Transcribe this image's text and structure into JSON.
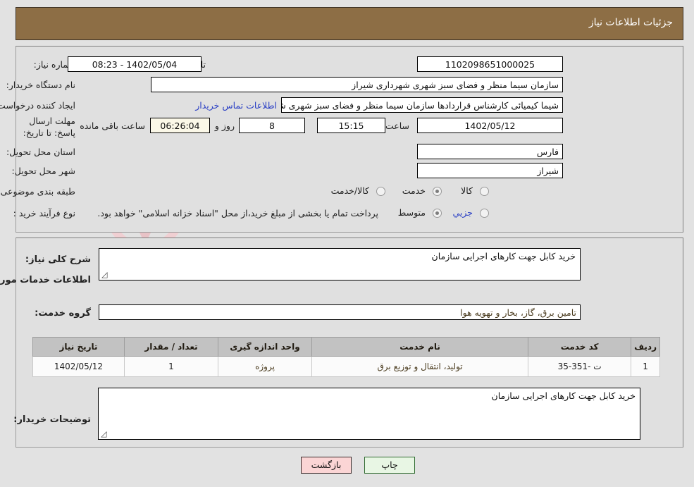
{
  "header": {
    "title": "جزئیات اطلاعات نیاز"
  },
  "form": {
    "need_number_label": "شماره نیاز:",
    "need_number_value": "1102098651000025",
    "announce_label": "تاریخ و ساعت اعلان عمومی:",
    "announce_value": "1402/05/04 - 08:23",
    "buyer_org_label": "نام دستگاه خریدار:",
    "buyer_org_value": "سازمان سیما منظر و فضای سبز شهری شهرداری شیراز",
    "creator_label": "ایجاد کننده درخواست:",
    "creator_value": "شیما کیمیائی کارشناس قراردادها سازمان سیما منظر و فضای سبز شهری شهـ",
    "contact_link": "اطلاعات تماس خریدار",
    "deadline_label": "مهلت ارسال پاسخ: تا تاریخ:",
    "deadline_date": "1402/05/12",
    "time_label": "ساعت",
    "deadline_time": "15:15",
    "days_value": "8",
    "days_label": "روز و",
    "countdown_value": "06:26:04",
    "remaining_label": "ساعت باقی مانده",
    "province_label": "استان محل تحویل:",
    "province_value": "فارس",
    "city_label": "شهر محل تحویل:",
    "city_value": "شیراز",
    "category_label": "طبقه بندی موضوعی:",
    "category_options": [
      {
        "label": "کالا",
        "selected": false
      },
      {
        "label": "خدمت",
        "selected": true
      },
      {
        "label": "کالا/خدمت",
        "selected": false
      }
    ],
    "process_label": "نوع فرآیند خرید :",
    "process_options": [
      {
        "label": "جزیي",
        "selected": false
      },
      {
        "label": "متوسط",
        "selected": true
      }
    ],
    "process_note": "پرداخت تمام یا بخشی از مبلغ خرید،از محل \"اسناد خزانه اسلامی\" خواهد بود."
  },
  "detail": {
    "summary_label": "شرح کلی نیاز:",
    "summary_value": "خرید کابل جهت کارهای اجرایی سازمان",
    "section_title": "اطلاعات خدمات مورد نیاز",
    "service_group_label": "گروه خدمت:",
    "service_group_value": "تامین برق، گاز، بخار و تهویه هوا",
    "comments_label": "توضیحات خریدار:",
    "comments_value": "خرید کابل جهت کارهای اجرایی سازمان"
  },
  "table": {
    "columns": [
      "ردیف",
      "کد خدمت",
      "نام خدمت",
      "واحد اندازه گیری",
      "تعداد / مقدار",
      "تاریخ نیاز"
    ],
    "rows": [
      {
        "row": "1",
        "code": "ت -351-35",
        "name": "تولید، انتقال و توزیع برق",
        "unit": "پروژه",
        "qty": "1",
        "date": "1402/05/12"
      }
    ]
  },
  "footer": {
    "back_label": "بازگشت",
    "print_label": "چاپ"
  },
  "watermark": {
    "text": "AriaTender.net"
  },
  "colors": {
    "header_bar": "#8d6e45",
    "panel_bg": "#e0e0e0",
    "page_bg": "#e2e2e2",
    "link": "#2a3fc4",
    "table_header": "#c2c2c2",
    "btn_back": "#fbd5d5",
    "btn_print": "#e8f6e4",
    "countdown_bg": "#fbf8e8"
  }
}
